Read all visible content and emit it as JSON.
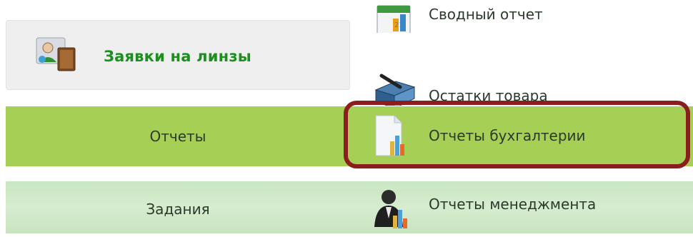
{
  "left_menu": {
    "lens_requests_label": "Заявки на линзы",
    "reports_label": "Отчеты",
    "tasks_label": "Задания"
  },
  "submenu": {
    "items": [
      {
        "label": "Сводный отчет",
        "icon": "calendar-chart-icon"
      },
      {
        "label": "Остатки товара",
        "icon": "stock-box-icon"
      },
      {
        "label": "Отчеты бухгалтерии",
        "icon": "document-chart-icon"
      },
      {
        "label": "Отчеты менеджмента",
        "icon": "manager-chart-icon"
      }
    ],
    "highlighted_index": 2
  },
  "colors": {
    "green_row": "#a6cf55",
    "lens_label": "#1d8f1f",
    "highlight_border": "#8b1d1d"
  }
}
